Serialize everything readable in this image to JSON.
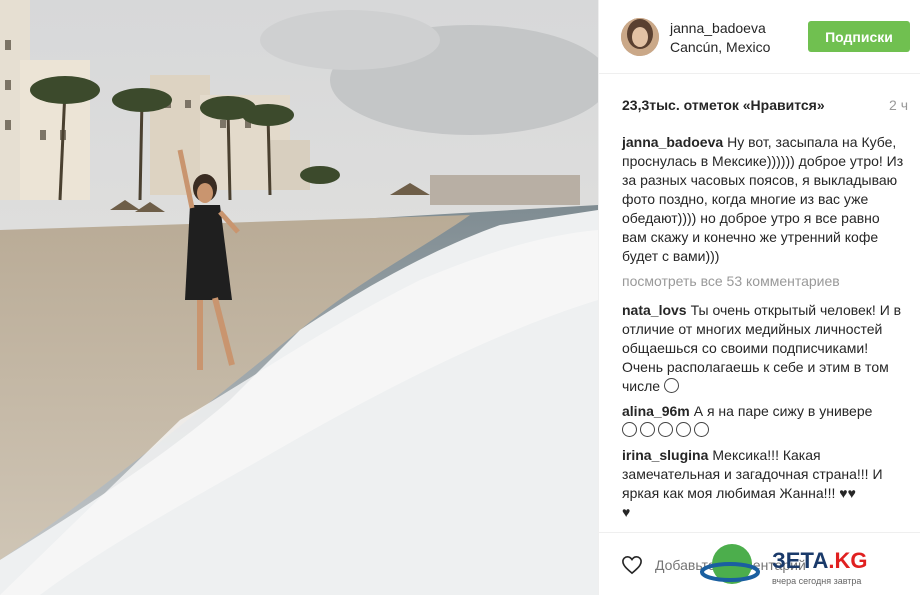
{
  "photo": {
    "description_icon": "beach-photo"
  },
  "header": {
    "username": "janna_badoeva",
    "location": "Cancún, Mexico",
    "follow_label": "Подписки"
  },
  "likes": "23,3тыс. отметок «Нравится»",
  "time": "2 ч",
  "caption": {
    "user": "janna_badoeva",
    "text": "Ну вот, засыпала на Кубе, проснулась в Мексике)))))) доброе утро! Из за разных часовых поясов, я выкладываю фото поздно, когда многие из вас уже обедают)))) но доброе утро я все равно вам скажу и конечно же утренний кофе будет с вами)))"
  },
  "view_all": "посмотреть все 53 комментариев",
  "comments": [
    {
      "user": "nata_lovs",
      "text": "Ты очень открытый человек! И в отличие от многих медийных личностей общаешься со своими подписчиками! Очень располагаешь к себе и этим в том числе"
    },
    {
      "user": "alina_96m",
      "text": "А я на паре сижу в универе"
    },
    {
      "user": "irina_slugina",
      "text": "Мексика!!! Какая замечательная и загадочная страна!!! И яркая как моя любимая Жанна!!!"
    }
  ],
  "footer": {
    "add_comment_placeholder": "Добавьте комментарий..."
  },
  "watermark": {
    "name": "ЗЕТА",
    "suffix": ".KG",
    "tagline": "вчера сегодня завтра"
  },
  "colors": {
    "follow_button": "#70c050",
    "muted": "#999999"
  }
}
